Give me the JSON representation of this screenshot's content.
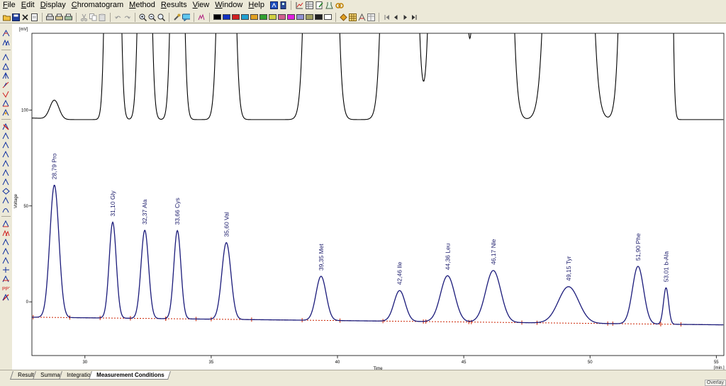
{
  "menu": {
    "items": [
      "File",
      "Edit",
      "Display",
      "Chromatogram",
      "Method",
      "Results",
      "View",
      "Window",
      "Help"
    ]
  },
  "colors": {
    "trace_top": "#000000",
    "trace_main": "#1a1a7a",
    "baseline": "#cc2200",
    "peak_label": "#1a1a6a",
    "toolbar_palette": [
      "#000000",
      "#1030c0",
      "#d02020",
      "#20a0d0",
      "#30a030",
      "#e0a020",
      "#e020e0",
      "#40c0c0",
      "#d0d040",
      "#d06090",
      "#9090d0",
      "#a0a060",
      "#202020"
    ]
  },
  "chart_data": {
    "type": "line",
    "ylabel": "Voltage",
    "yunit": "[mV]",
    "xlabel": "Time",
    "xunit": "[min.]",
    "xlim": [
      27.9,
      55.3
    ],
    "ylim": [
      -28,
      140
    ],
    "xticks": [
      30,
      35,
      40,
      45,
      50,
      55
    ],
    "yticks": [
      0,
      50,
      100
    ],
    "baseline": {
      "start": -8,
      "end": -12
    },
    "detector_offset": 95,
    "peaks": [
      {
        "rt": 28.79,
        "name": "Pro",
        "label": "28,79 Pro",
        "height": 69,
        "width": 0.18,
        "height_top": 10,
        "top_width": 0.18,
        "bounds": [
          27.95,
          29.4
        ]
      },
      {
        "rt": 31.1,
        "name": "Gly",
        "label": "31,10 Gly",
        "height": 50,
        "width": 0.14,
        "height_top": 600,
        "top_width": 0.16,
        "bounds": [
          30.6,
          31.8
        ]
      },
      {
        "rt": 32.37,
        "name": "Ala",
        "label": "32,37 Ala",
        "height": 46,
        "width": 0.15,
        "height_top": 300,
        "top_width": 0.16,
        "bounds": [
          31.8,
          33.2
        ]
      },
      {
        "rt": 33.66,
        "name": "Cys",
        "label": "33,66 Cys",
        "height": 46,
        "width": 0.14,
        "height_top": 300,
        "top_width": 0.16,
        "bounds": [
          33.2,
          34.4
        ]
      },
      {
        "rt": 35.6,
        "name": "Val",
        "label": "35,60 Val",
        "height": 40,
        "width": 0.18,
        "height_top": 400,
        "top_width": 0.2,
        "bounds": [
          35.0,
          36.6
        ]
      },
      {
        "rt": 39.35,
        "name": "Met",
        "label": "39,35 Met",
        "height": 23,
        "width": 0.2,
        "height_top": 1500,
        "top_width": 0.28,
        "bounds": [
          38.6,
          40.1
        ]
      },
      {
        "rt": 42.46,
        "name": "Ile",
        "label": "42,46 Ile",
        "height": 16,
        "width": 0.22,
        "height_top": 1500,
        "top_width": 0.3,
        "bounds": [
          41.8,
          43.4
        ]
      },
      {
        "rt": 44.36,
        "name": "Leu",
        "label": "44,36 Leu",
        "height": 24,
        "width": 0.28,
        "height_top": 1500,
        "top_width": 0.3,
        "bounds": [
          43.5,
          45.2
        ]
      },
      {
        "rt": 46.17,
        "name": "Nle",
        "label": "46,17 Nle",
        "height": 27,
        "width": 0.3,
        "height_top": 1500,
        "top_width": 0.32,
        "bounds": [
          45.3,
          47.3
        ]
      },
      {
        "rt": 49.15,
        "name": "Tyr",
        "label": "49,15 Tyr",
        "height": 19,
        "width": 0.4,
        "height_top": 1500,
        "top_width": 0.4,
        "bounds": [
          47.9,
          50.7
        ]
      },
      {
        "rt": 51.9,
        "name": "Phe",
        "label": "51,90 Phe",
        "height": 30,
        "width": 0.22,
        "height_top": 1500,
        "top_width": 0.3,
        "bounds": [
          50.9,
          52.8
        ]
      },
      {
        "rt": 53.01,
        "name": "b-Ala",
        "label": "53,01 b-Ala",
        "height": 19,
        "width": 0.1,
        "height_top": 1000,
        "top_width": 0.12,
        "bounds": [
          52.8,
          53.6
        ]
      }
    ]
  },
  "tabs": {
    "items": [
      "Results",
      "Summary",
      "Integration",
      "Measurement Conditions"
    ],
    "active": 3
  },
  "status": {
    "overlay": "Overlay"
  }
}
